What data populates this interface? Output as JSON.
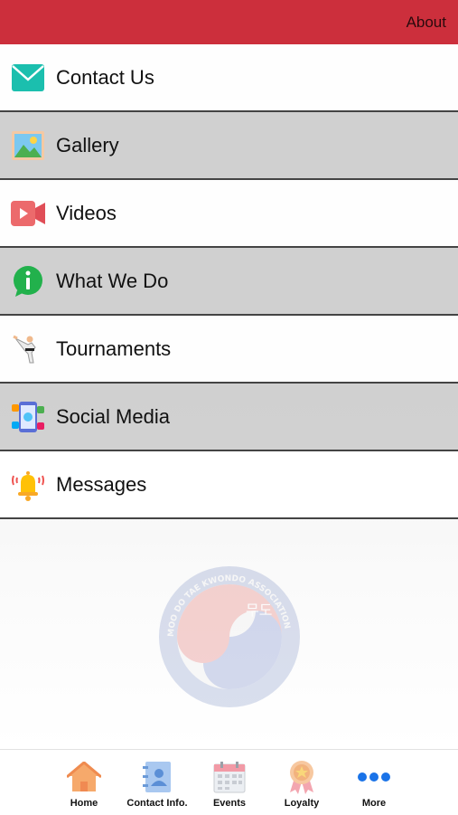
{
  "header": {
    "title": "About"
  },
  "menu": {
    "items": [
      {
        "label": "Contact Us",
        "icon": "envelope-icon"
      },
      {
        "label": "Gallery",
        "icon": "picture-icon"
      },
      {
        "label": "Videos",
        "icon": "video-camera-icon"
      },
      {
        "label": "What We Do",
        "icon": "info-icon"
      },
      {
        "label": "Tournaments",
        "icon": "martial-arts-kick-icon"
      },
      {
        "label": "Social Media",
        "icon": "social-media-phone-icon"
      },
      {
        "label": "Messages",
        "icon": "bell-icon"
      }
    ]
  },
  "watermark": {
    "ring_text": "MOO DO TAE KWONDO ASSOCIATION",
    "center_text": "무도"
  },
  "tabbar": {
    "tabs": [
      {
        "label": "Home",
        "icon": "house-icon"
      },
      {
        "label": "Contact Info.",
        "icon": "address-book-icon"
      },
      {
        "label": "Events",
        "icon": "calendar-icon"
      },
      {
        "label": "Loyalty",
        "icon": "award-ribbon-icon"
      },
      {
        "label": "More",
        "icon": "more-dots-icon"
      }
    ]
  },
  "colors": {
    "header_bg": "#cc2f3c",
    "row_light": "#ffffff",
    "row_dark": "#cdcdcd",
    "more_blue": "#1a73e8"
  }
}
